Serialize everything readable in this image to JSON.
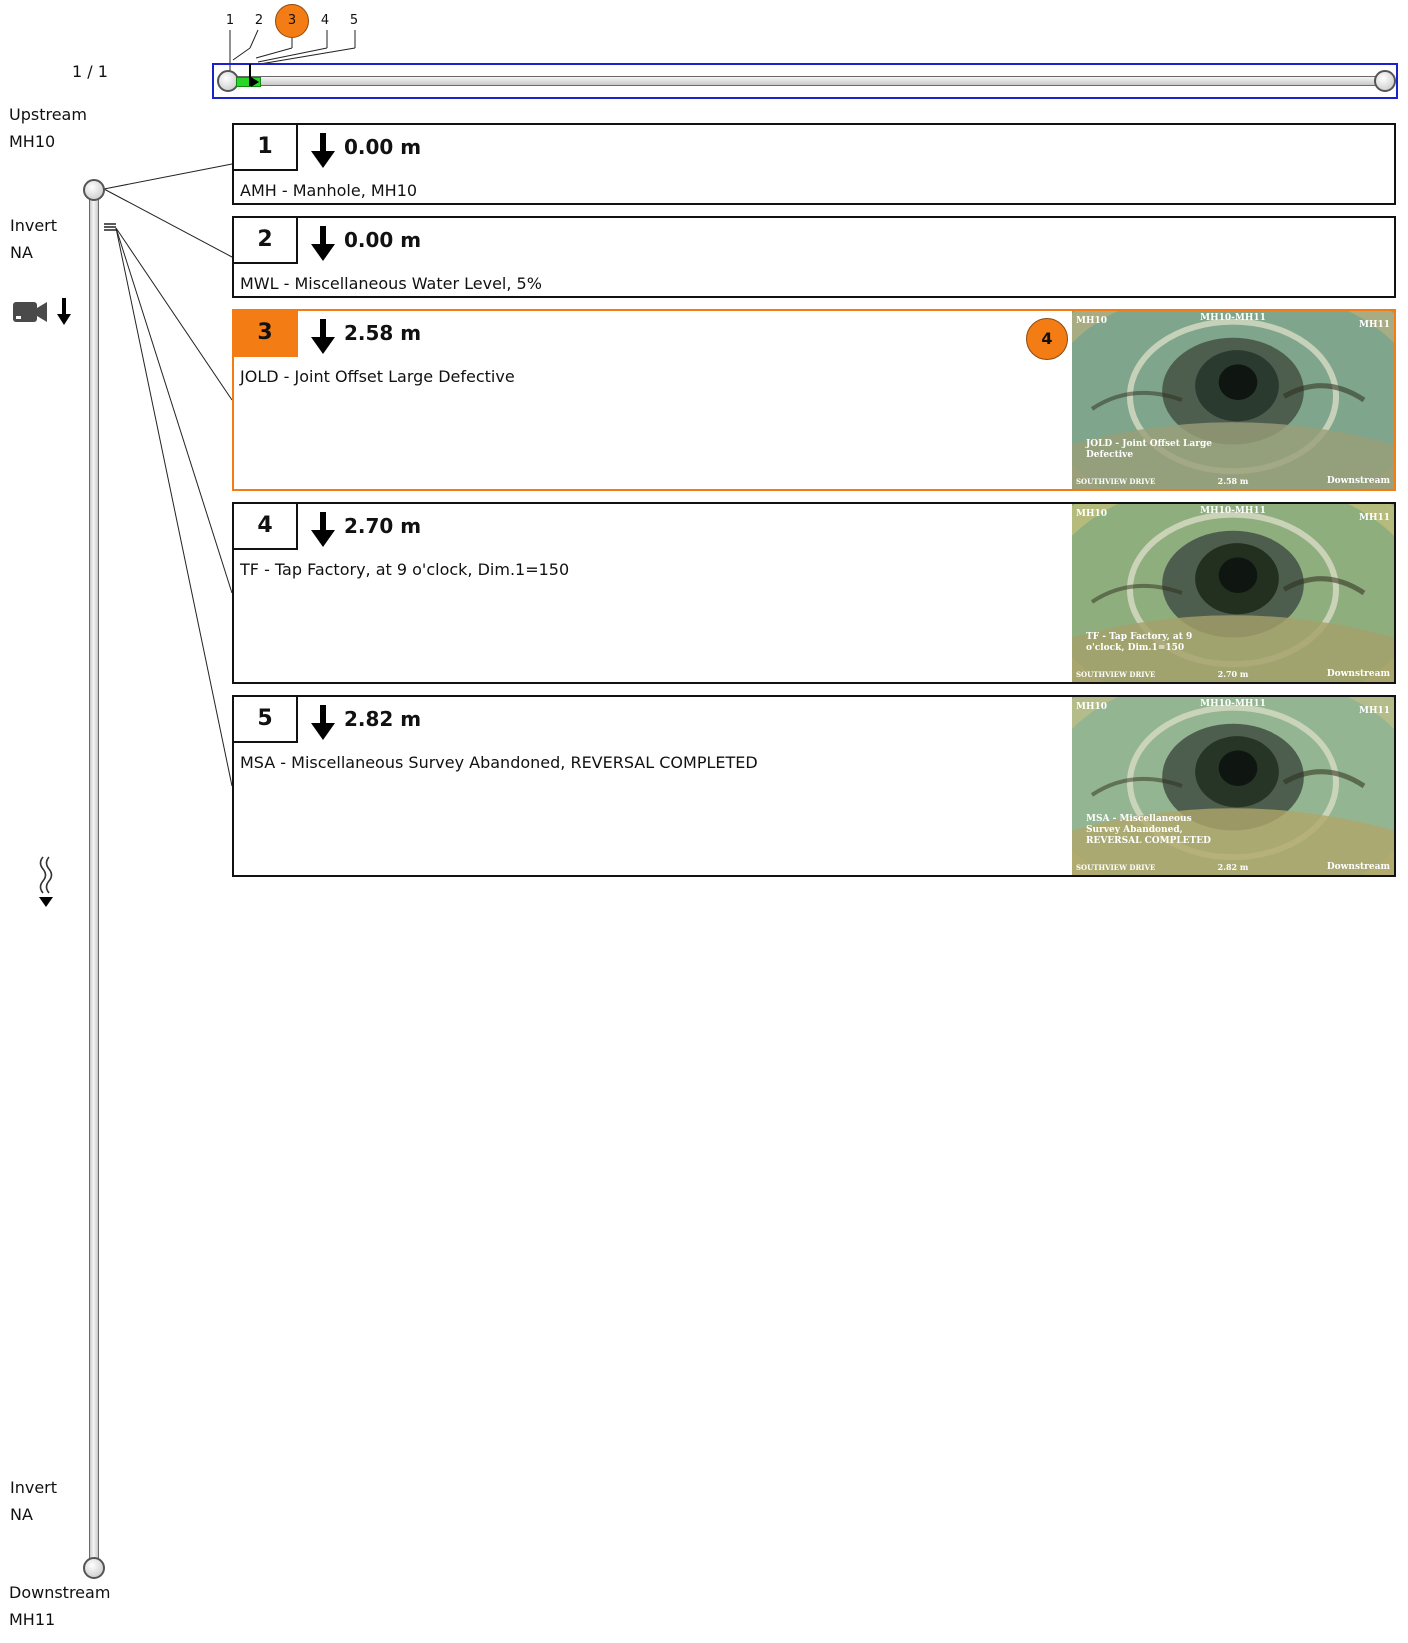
{
  "page_counter": "1 / 1",
  "timeline": {
    "ticks": [
      "1",
      "2",
      "3",
      "4",
      "5"
    ],
    "active_tick": "3",
    "progress_percent": 2.2
  },
  "pipe": {
    "upstream_label": "Upstream",
    "upstream_id": "MH10",
    "downstream_label": "Downstream",
    "downstream_id": "MH11",
    "top_invert_label": "Invert",
    "top_invert_value": "NA",
    "bottom_invert_label": "Invert",
    "bottom_invert_value": "NA",
    "icons": [
      "camera-icon",
      "arrow-down-icon",
      "flow-direction-icon"
    ]
  },
  "observations": [
    {
      "number": "1",
      "distance": "0.00 m",
      "description": "AMH - Manhole, MH10",
      "active": false,
      "has_photo": false
    },
    {
      "number": "2",
      "distance": "0.00 m",
      "description": "MWL - Miscellaneous Water Level, 5%",
      "active": false,
      "has_photo": false
    },
    {
      "number": "3",
      "distance": "2.58 m",
      "description": "JOLD - Joint Offset Large Defective",
      "active": true,
      "has_photo": true,
      "photo_badge": "4",
      "photo": {
        "header_left": "MH10",
        "header_center": "MH10-MH11",
        "header_right": "MH11",
        "caption_lines": [
          "JOLD - Joint Offset Large",
          "Defective"
        ],
        "footer_left": "SOUTHVIEW DRIVE",
        "footer_distance": "2.58 m",
        "footer_right": "Downstream"
      }
    },
    {
      "number": "4",
      "distance": "2.70 m",
      "description": "TF - Tap Factory, at 9 o'clock, Dim.1=150",
      "active": false,
      "has_photo": true,
      "photo": {
        "header_left": "MH10",
        "header_center": "MH10-MH11",
        "header_right": "MH11",
        "caption_lines": [
          "TF - Tap Factory, at 9",
          "o'clock, Dim.1=150"
        ],
        "footer_left": "SOUTHVIEW DRIVE",
        "footer_distance": "2.70 m",
        "footer_right": "Downstream"
      }
    },
    {
      "number": "5",
      "distance": "2.82 m",
      "description": "MSA - Miscellaneous Survey Abandoned, REVERSAL COMPLETED",
      "active": false,
      "has_photo": true,
      "photo": {
        "header_left": "MH10",
        "header_center": "MH10-MH11",
        "header_right": "MH11",
        "caption_lines": [
          "MSA - Miscellaneous",
          "Survey Abandoned,",
          "REVERSAL COMPLETED"
        ],
        "footer_left": "SOUTHVIEW DRIVE",
        "footer_distance": "2.82 m",
        "footer_right": "Downstream"
      }
    }
  ],
  "colors": {
    "accent": "#f47c14",
    "timeline_border": "#1c22c9",
    "progress_fill": "#27d627"
  }
}
